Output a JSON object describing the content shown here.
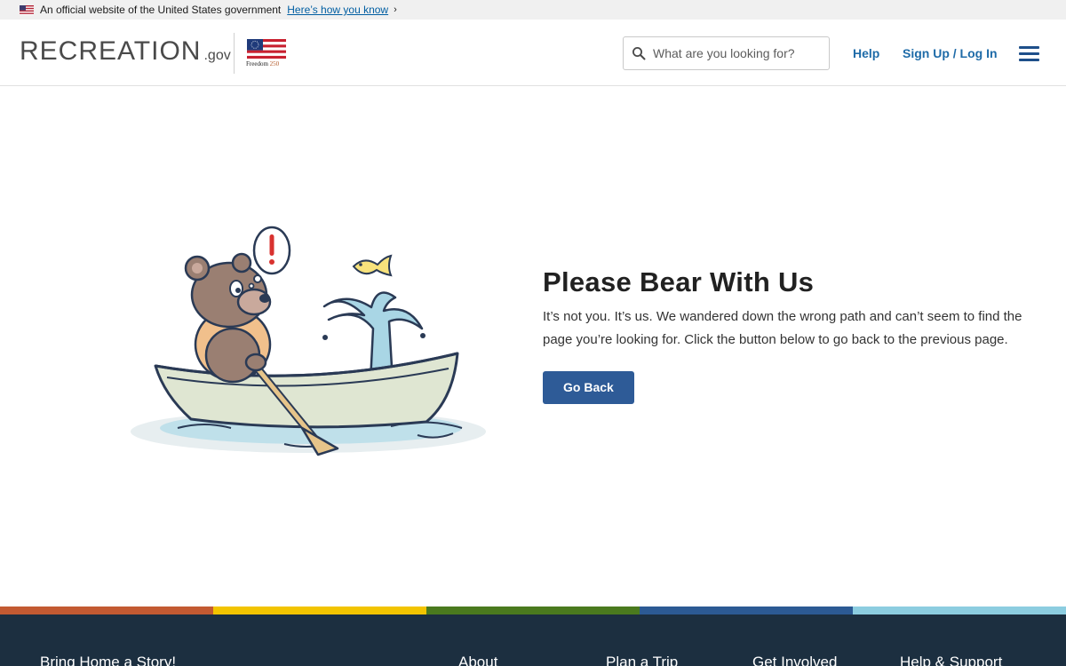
{
  "gov_banner": {
    "text": "An official website of the United States government",
    "link": "Here’s how you know"
  },
  "header": {
    "logo_main": "RECREATION",
    "logo_gov": ".gov",
    "freedom_word": "Freedom",
    "freedom_year": "250",
    "search_placeholder": "What are you looking for?",
    "help": "Help",
    "signup": "Sign Up / Log In"
  },
  "main": {
    "title": "Please Bear With Us",
    "message": "It’s not you. It’s us. We wandered down the wrong path and can’t seem to find the page you’re looking for. Click the button below to go back to the previous page.",
    "button": "Go Back"
  },
  "color_bar": [
    "#c35a32",
    "#f2c400",
    "#4a7a1e",
    "#2c5a94",
    "#8ccde0"
  ],
  "colors": {
    "primary_button": "#2e5b97",
    "nav_link": "#1e6ba8",
    "footer_bg": "#1c2f40"
  },
  "icons": {
    "search": "search-icon",
    "menu": "hamburger-menu-icon"
  },
  "footer": {
    "headings": [
      "Bring Home a Story!",
      "About",
      "Plan a Trip",
      "Get Involved",
      "Help & Support"
    ]
  }
}
